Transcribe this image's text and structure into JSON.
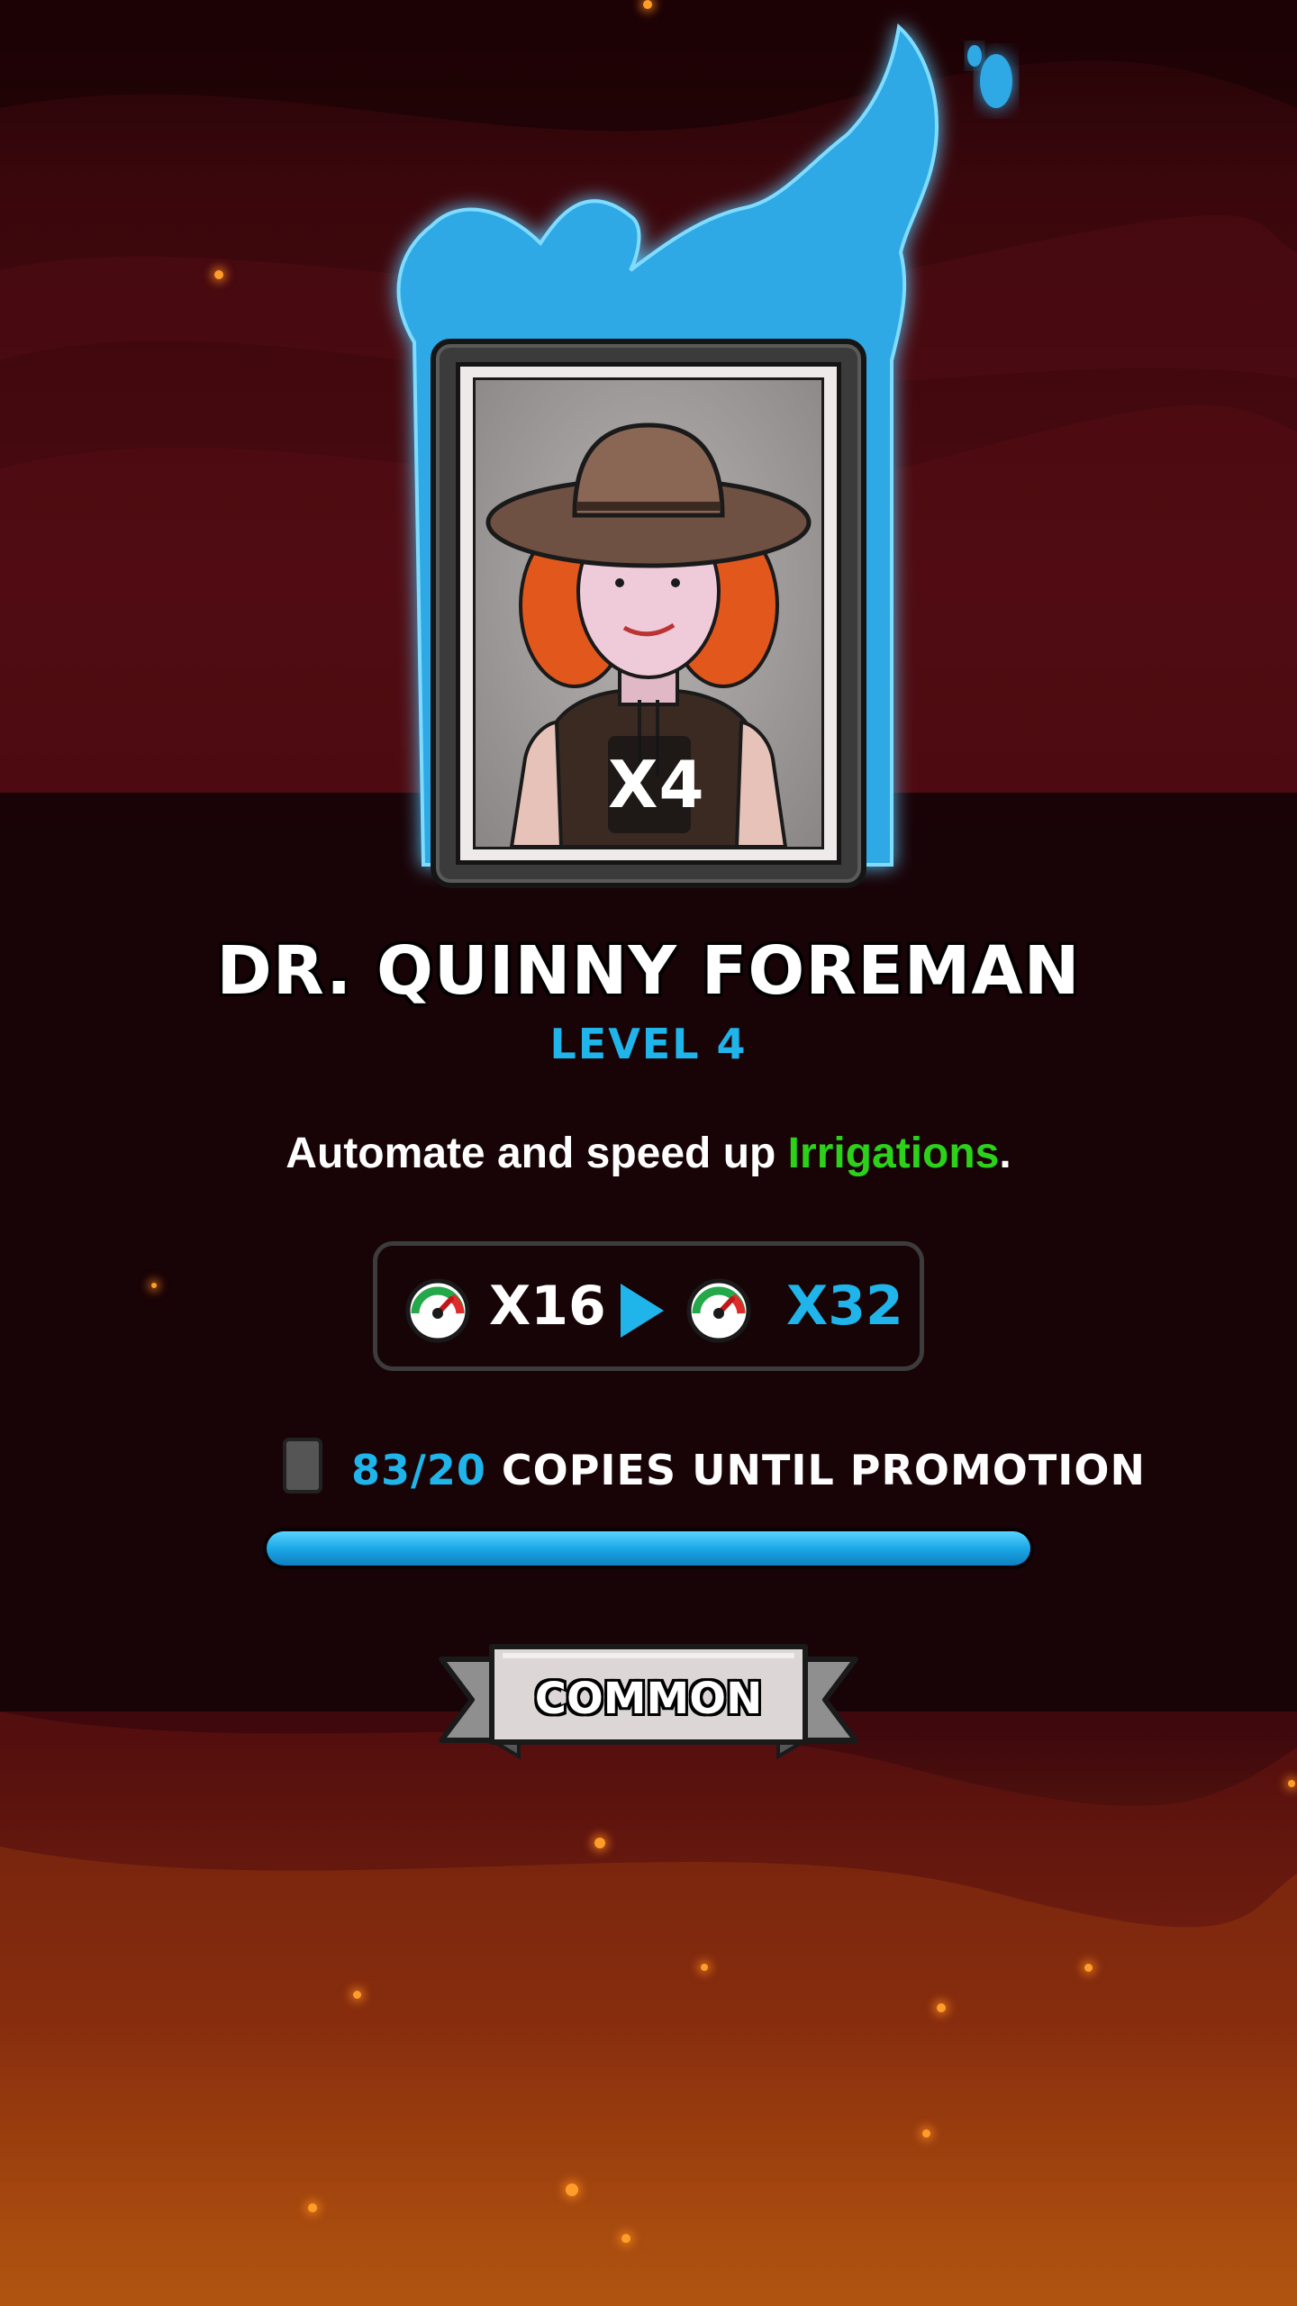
{
  "character": {
    "name": "DR. QUINNY FOREMAN",
    "level_label": "LEVEL 4",
    "card_count": "X4"
  },
  "description": {
    "before": "Automate and speed up ",
    "highlight": "Irrigations",
    "after": "."
  },
  "stat": {
    "icon": "speed-gauge-icon",
    "current": "X16",
    "next": "X32"
  },
  "promotion": {
    "copies": "83/20",
    "label": "COPIES UNTIL PROMOTION",
    "progress": 1.0
  },
  "rarity": "COMMON",
  "colors": {
    "accent_blue": "#1fb4ea",
    "highlight_green": "#2cd11a",
    "flame_blue": "#3ab8f0"
  }
}
